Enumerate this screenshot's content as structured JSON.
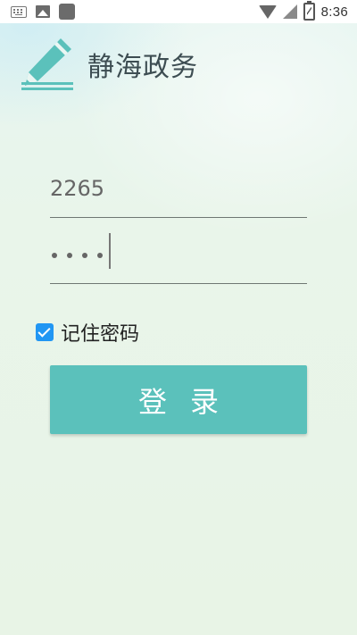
{
  "status_bar": {
    "icons": [
      "keyboard-icon",
      "image-icon",
      "square-icon",
      "wifi-icon",
      "signal-icon",
      "battery-icon"
    ],
    "time": "8:36"
  },
  "header": {
    "logo_icon": "pencil-icon",
    "title": "静海政务"
  },
  "login_form": {
    "username_value": "2265",
    "password_mask_count": 4,
    "remember_label": "记住密码",
    "remember_checked": true,
    "login_label": "登录"
  },
  "colors": {
    "accent": "#5bc1bb",
    "checkbox": "#2196f3",
    "logo": "#5bc1bb"
  }
}
